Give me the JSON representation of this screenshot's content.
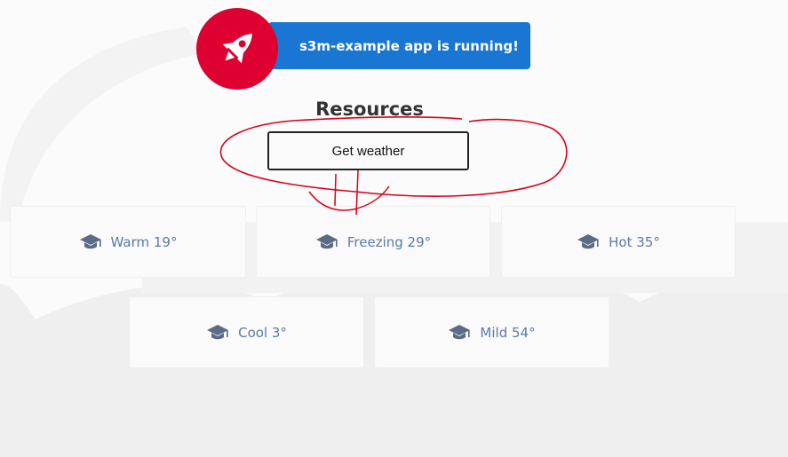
{
  "toolbar": {
    "title": "s3m-example app is running!",
    "logo_icon": "rocket-icon",
    "accent_color": "#1976d2",
    "logo_color": "#dd0031"
  },
  "resources": {
    "title": "Resources",
    "button_label": "Get weather"
  },
  "cards": [
    {
      "label": "Warm 19°",
      "icon": "graduation-cap-icon"
    },
    {
      "label": "Freezing 29°",
      "icon": "graduation-cap-icon"
    },
    {
      "label": "Hot 35°",
      "icon": "graduation-cap-icon"
    },
    {
      "label": "Cool 3°",
      "icon": "graduation-cap-icon"
    },
    {
      "label": "Mild 54°",
      "icon": "graduation-cap-icon"
    }
  ]
}
